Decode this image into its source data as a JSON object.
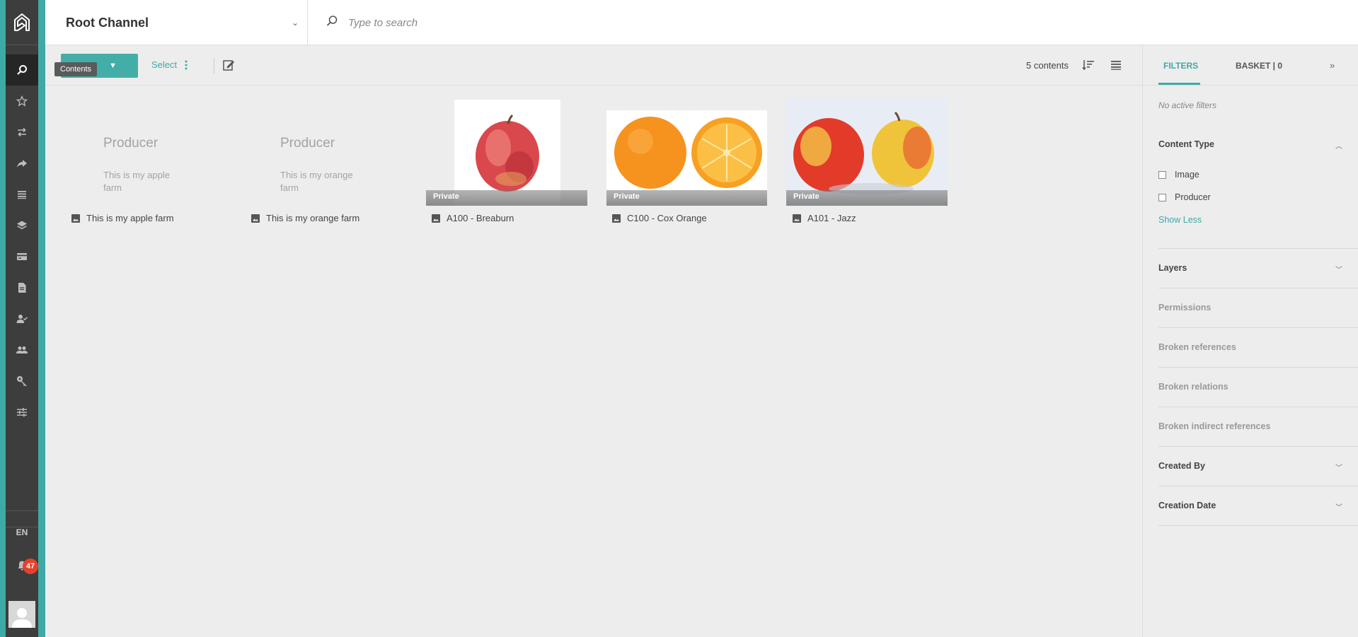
{
  "sidebar": {
    "tooltip": "Contents",
    "language": "EN",
    "notifications_count": "47",
    "nav": [
      "search",
      "favorites",
      "transfers",
      "shares",
      "list",
      "layers",
      "cards",
      "documents",
      "user-check",
      "groups",
      "key",
      "settings"
    ]
  },
  "header": {
    "channel_title": "Root Channel",
    "search_placeholder": "Type to search"
  },
  "toolbar": {
    "add_label": "Add",
    "select_label": "Select",
    "count_label": "5 contents"
  },
  "contents": [
    {
      "type": "producer",
      "title": "Producer",
      "description": "This is my apple farm",
      "caption": "This is my apple farm"
    },
    {
      "type": "producer",
      "title": "Producer",
      "description": "This is my orange farm",
      "caption": "This is my orange farm"
    },
    {
      "type": "image",
      "status": "Private",
      "caption": "A100 - Breaburn"
    },
    {
      "type": "image",
      "status": "Private",
      "caption": "C100 - Cox Orange"
    },
    {
      "type": "image",
      "status": "Private",
      "caption": "A101 - Jazz"
    }
  ],
  "panel": {
    "tabs": {
      "filters": "FILTERS",
      "basket": "BASKET | 0"
    },
    "no_active_filters": "No active filters",
    "content_type": {
      "title": "Content Type",
      "options": [
        "Image",
        "Producer"
      ],
      "show_less": "Show Less"
    },
    "sections": {
      "layers": "Layers",
      "permissions": "Permissions",
      "broken_references": "Broken references",
      "broken_relations": "Broken relations",
      "broken_indirect_references": "Broken indirect references",
      "created_by": "Created By",
      "creation_date": "Creation Date"
    }
  },
  "colors": {
    "accent": "#3fa9a5",
    "sidebar": "#3d3d3d",
    "badge": "#e8402a"
  }
}
